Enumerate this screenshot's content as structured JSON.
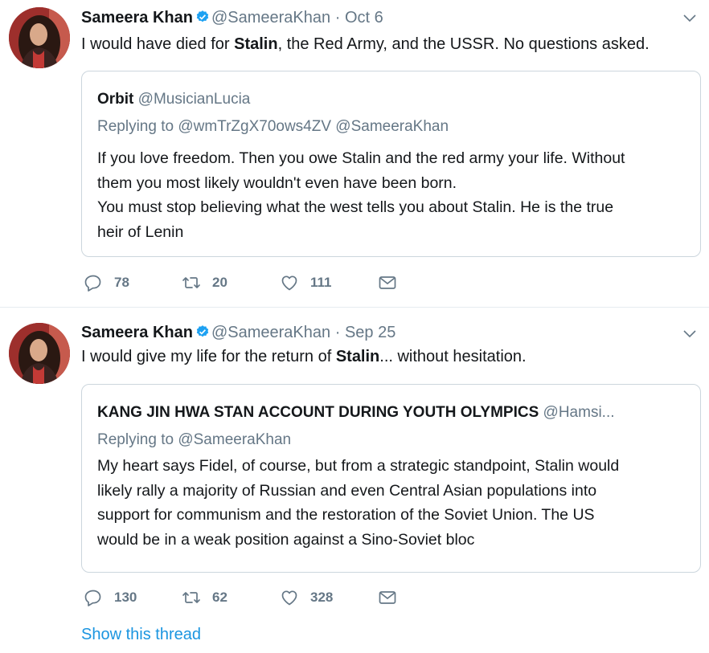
{
  "tweets": [
    {
      "author_name": "Sameera Khan",
      "author_handle": "@SameeraKhan",
      "separator": "·",
      "date": "Oct 6",
      "text_before": "I would have died for ",
      "text_bold": "Stalin",
      "text_after": ", the Red Army, and the USSR. No questions asked.",
      "quote": {
        "name": "Orbit",
        "handle": "@MusicianLucia",
        "reply_label": "Replying to",
        "reply_mentions": "@wmTrZgX70ows4ZV @SameeraKhan",
        "lines": [
          "If you love freedom. Then you owe Stalin and the red army your life. Without",
          "them you most likely wouldn't even have been born.",
          "You must stop believing what the west tells you about Stalin. He is the true",
          "heir of Lenin"
        ]
      },
      "replies": "78",
      "retweets": "20",
      "likes": "111"
    },
    {
      "author_name": "Sameera Khan",
      "author_handle": "@SameeraKhan",
      "separator": "·",
      "date": "Sep 25",
      "text_before": "I would give my life for the return of ",
      "text_bold": "Stalin",
      "text_after": "... without hesitation.",
      "quote": {
        "name": "KANG JIN HWA STAN ACCOUNT DURING YOUTH OLYMPICS",
        "handle": "@Hamsi...",
        "reply_label": "Replying to",
        "reply_mentions": "@SameeraKhan",
        "lines": [
          "My heart says Fidel, of course, but from a strategic standpoint, Stalin would",
          "likely rally a majority of Russian and even Central Asian populations into",
          "support for communism and the restoration of the Soviet Union. The US",
          "would be in a weak position against a Sino-Soviet bloc"
        ]
      },
      "replies": "130",
      "retweets": "62",
      "likes": "328"
    }
  ],
  "show_thread": "Show this thread",
  "icons": {
    "verified": "verified-badge-icon",
    "caret": "chevron-down-icon",
    "reply": "reply-icon",
    "retweet": "retweet-icon",
    "like": "heart-icon",
    "dm": "envelope-icon"
  },
  "colors": {
    "link": "#1b95e0",
    "verified": "#1da1f2",
    "muted": "#657786"
  }
}
